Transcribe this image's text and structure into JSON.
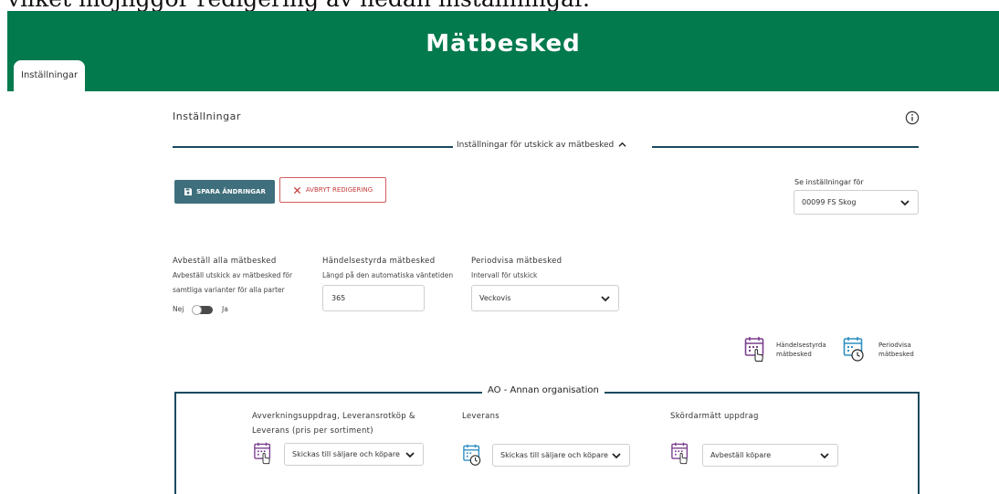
{
  "caption": "vilket möjliggör redigering av nedan inställningar.",
  "banner": {
    "title": "Mätbesked"
  },
  "tabs": [
    {
      "label": "Inställningar"
    }
  ],
  "main": {
    "title": "Inställningar",
    "info_icon": "info-icon",
    "section": {
      "label": "Inställningar för utskick av mätbesked",
      "icon": "chevron-up-icon"
    },
    "buttons": {
      "save": {
        "label": "SPARA ÄNDRINGAR",
        "icon": "save-icon"
      },
      "cancel": {
        "label": "AVBRYT REDIGERING",
        "icon": "close-icon"
      }
    },
    "view_for": {
      "label": "Se inställningar för",
      "value": "00099 FS Skog"
    },
    "cancel_all": {
      "title": "Avbeställ alla mätbesked",
      "desc_line1": "Avbeställ utskick av mätbesked för",
      "desc_line2": "samtliga varianter för alla parter",
      "toggle_off": "Nej",
      "toggle_on": "Ja",
      "toggle_state": false
    },
    "event_driven": {
      "title": "Händelsestyrda mätbesked",
      "desc": "Längd på den automatiska väntetiden",
      "value": "365"
    },
    "periodic": {
      "title": "Periodvisa mätbesked",
      "desc": "Intervall för utskick",
      "value": "Veckovis"
    },
    "legend": [
      {
        "line1": "Händelsestyrda",
        "line2": "mätbesked",
        "icon": "calendar-hand-icon"
      },
      {
        "line1": "Periodvisa",
        "line2": "mätbesked",
        "icon": "calendar-clock-icon"
      }
    ],
    "org": {
      "title": "AO - Annan organisation",
      "columns": [
        {
          "title_line1": "Avverkningsuppdrag, Leveransrotköp &",
          "title_line2": "Leverans (pris per sortiment)",
          "value": "Skickas till säljare och köpare",
          "icon": "calendar-hand-icon"
        },
        {
          "title_line1": "Leverans",
          "title_line2": "",
          "value": "Skickas till säljare och köpare",
          "icon": "calendar-clock-icon"
        },
        {
          "title_line1": "Skördarmätt uppdrag",
          "title_line2": "",
          "value": "Avbeställ köpare",
          "icon": "calendar-hand-icon"
        }
      ]
    }
  },
  "colors": {
    "brand": "#037a4e",
    "primary_button": "#3f6f7c",
    "cancel": "#d65c5c",
    "purple_icon": "#7b3f8f",
    "blue_icon": "#2f8fc2"
  }
}
